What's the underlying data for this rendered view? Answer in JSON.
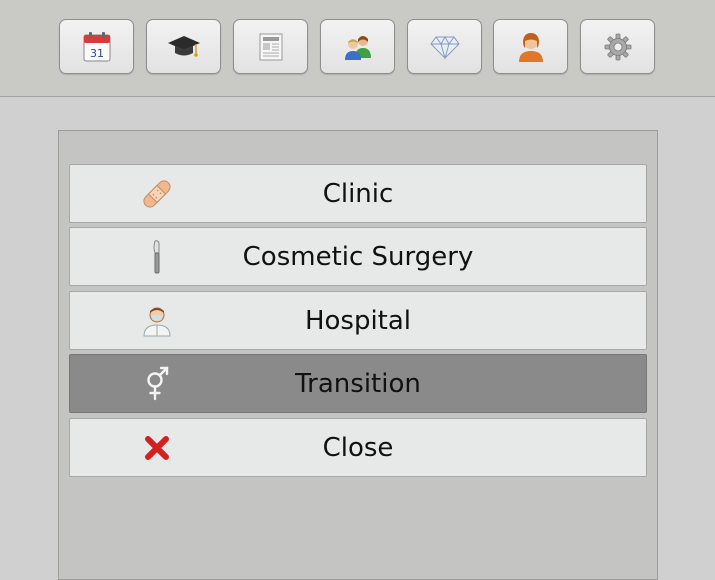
{
  "toolbar": {
    "buttons": [
      {
        "id": "calendar",
        "icon": "calendar-icon",
        "date_text": "31"
      },
      {
        "id": "education",
        "icon": "graduation-cap-icon"
      },
      {
        "id": "news",
        "icon": "newspaper-icon"
      },
      {
        "id": "relationships",
        "icon": "people-icon"
      },
      {
        "id": "assets",
        "icon": "diamond-icon"
      },
      {
        "id": "profile",
        "icon": "person-icon"
      },
      {
        "id": "settings",
        "icon": "gear-icon"
      }
    ]
  },
  "menu": {
    "items": [
      {
        "label": "Clinic",
        "icon": "bandage-icon",
        "selected": false
      },
      {
        "label": "Cosmetic Surgery",
        "icon": "scalpel-icon",
        "selected": false
      },
      {
        "label": "Hospital",
        "icon": "doctor-icon",
        "selected": false
      },
      {
        "label": "Transition",
        "icon": "transgender-symbol-icon",
        "selected": true
      },
      {
        "label": "Close",
        "icon": "red-x-icon",
        "selected": false
      }
    ]
  },
  "colors": {
    "selected_bg": "#8a8a8a",
    "item_bg": "#e7e8e8",
    "close_red": "#d42020"
  }
}
